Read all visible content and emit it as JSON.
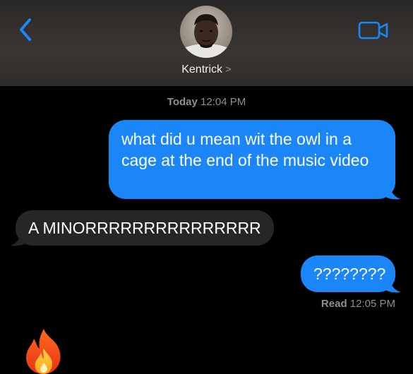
{
  "header": {
    "back_icon": "chevron-left-icon",
    "video_icon": "video-camera-icon",
    "contact_name": "Kentrick",
    "contact_chevron": ">",
    "accent_color": "#1b86f8"
  },
  "thread": {
    "timestamp_day": "Today",
    "timestamp_time": "12:04 PM",
    "messages": [
      {
        "direction": "sent",
        "text": "what did u mean wit the owl in a cage at the end of the music video"
      },
      {
        "direction": "received",
        "text": "A MINORRRRRRRRRRRRRRR"
      },
      {
        "direction": "sent",
        "text": "????????"
      }
    ],
    "receipt_label": "Read",
    "receipt_time": "12:05 PM",
    "trailing_emoji_icon": "fire-emoji-icon"
  },
  "colors": {
    "sent_bubble": "#1b86f8",
    "received_bubble": "#262629",
    "background": "#000000"
  }
}
